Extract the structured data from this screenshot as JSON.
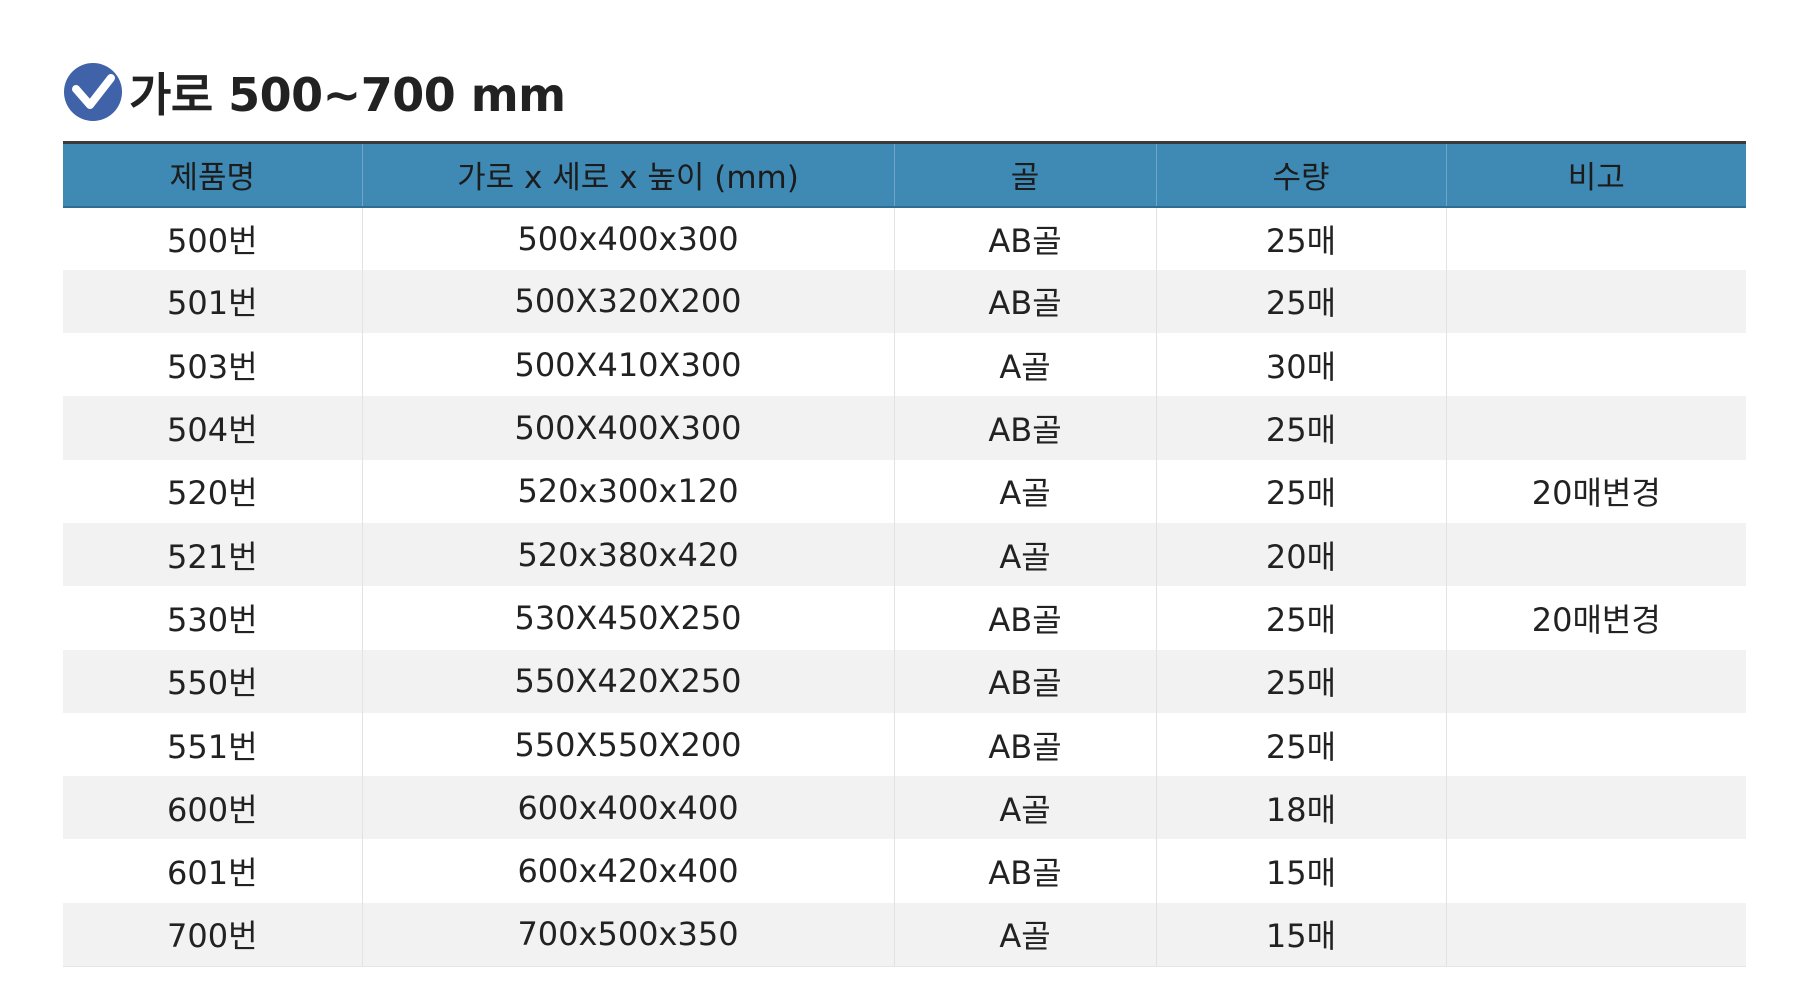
{
  "section": {
    "title": "가로 500~700 mm",
    "icon": "check-circle-icon",
    "icon_color": "#3f62a8"
  },
  "table": {
    "header_color": "#3f89b5",
    "columns": [
      "제품명",
      "가로 x 세로 x 높이 (mm)",
      "골",
      "수량",
      "비고"
    ],
    "rows": [
      [
        "500번",
        "500x400x300",
        "AB골",
        "25매",
        ""
      ],
      [
        "501번",
        "500X320X200",
        "AB골",
        "25매",
        ""
      ],
      [
        "503번",
        "500X410X300",
        "A골",
        "30매",
        ""
      ],
      [
        "504번",
        "500X400X300",
        "AB골",
        "25매",
        ""
      ],
      [
        "520번",
        "520x300x120",
        "A골",
        "25매",
        "20매변경"
      ],
      [
        "521번",
        "520x380x420",
        "A골",
        "20매",
        ""
      ],
      [
        "530번",
        "530X450X250",
        "AB골",
        "25매",
        "20매변경"
      ],
      [
        "550번",
        "550X420X250",
        "AB골",
        "25매",
        ""
      ],
      [
        "551번",
        "550X550X200",
        "AB골",
        "25매",
        ""
      ],
      [
        "600번",
        "600x400x400",
        "A골",
        "18매",
        ""
      ],
      [
        "601번",
        "600x420x400",
        "AB골",
        "15매",
        ""
      ],
      [
        "700번",
        "700x500x350",
        "A골",
        "15매",
        ""
      ]
    ]
  }
}
